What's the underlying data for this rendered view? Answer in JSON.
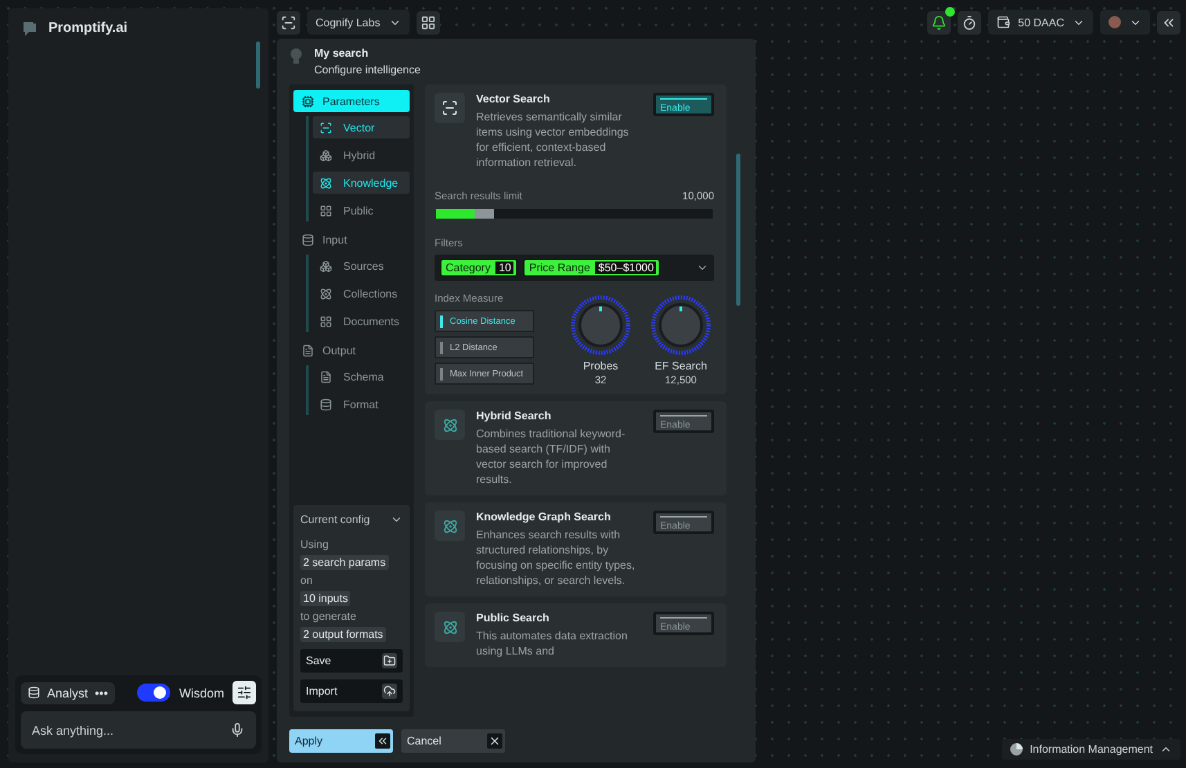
{
  "sidebar": {
    "brand": "Promptify.ai",
    "agent": "Analyst",
    "agent_menu": "•••",
    "wisdom": {
      "label": "Wisdom",
      "on": true
    },
    "ask": {
      "placeholder": "Ask anything..."
    }
  },
  "topbar": {
    "workspace": "Cognify Labs",
    "balance": "50 DAAC",
    "notifications": true
  },
  "panel": {
    "title": "My search",
    "subtitle": "Configure intelligence",
    "nav": [
      {
        "label": "Parameters",
        "selected": true,
        "children": [
          {
            "label": "Vector",
            "active": true
          },
          {
            "label": "Hybrid",
            "active": false
          },
          {
            "label": "Knowledge",
            "active": true
          },
          {
            "label": "Public",
            "active": false
          }
        ]
      },
      {
        "label": "Input",
        "selected": false,
        "children": [
          {
            "label": "Sources",
            "active": false
          },
          {
            "label": "Collections",
            "active": false
          },
          {
            "label": "Documents",
            "active": false
          }
        ]
      },
      {
        "label": "Output",
        "selected": false,
        "children": [
          {
            "label": "Schema",
            "active": false
          },
          {
            "label": "Format",
            "active": false
          }
        ]
      }
    ],
    "config": {
      "title": "Current config",
      "parts": [
        {
          "kind": "text",
          "text": "Using"
        },
        {
          "kind": "tag",
          "text": "2 search params"
        },
        {
          "kind": "text",
          "text": "on"
        },
        {
          "kind": "tag",
          "text": "10 inputs"
        },
        {
          "kind": "text",
          "text": "to generate"
        },
        {
          "kind": "tag",
          "text": "2 output formats"
        }
      ],
      "actions": [
        "Save",
        "Import"
      ]
    },
    "cards": [
      {
        "title": "Vector Search",
        "description": "Retrieves semantically similar items using vector embeddings for efficient, context-based information retrieval.",
        "enable": "Enable",
        "on": true,
        "details": {
          "limit_label": "Search results limit",
          "limit_value": "10,000",
          "level": 0.14,
          "filters_label": "Filters",
          "filters": [
            {
              "label": "Category",
              "value": "10"
            },
            {
              "label": "Price Range",
              "value": "$50–$1000"
            }
          ],
          "measure_label": "Index Measure",
          "measures": [
            {
              "label": "Cosine Distance",
              "selected": true
            },
            {
              "label": "L2 Distance",
              "selected": false
            },
            {
              "label": "Max Inner Product",
              "selected": false
            }
          ],
          "knobs": [
            {
              "label": "Probes",
              "value": "32"
            },
            {
              "label": "EF Search",
              "value": "12,500"
            }
          ]
        }
      },
      {
        "title": "Hybrid Search",
        "description": "Combines traditional keyword-based search (TF/IDF) with vector search for improved results.",
        "enable": "Enable",
        "on": false
      },
      {
        "title": "Knowledge Graph Search",
        "description": "Enhances search results with structured relationships, by focusing on specific entity types, relationships, or search levels.",
        "enable": "Enable",
        "on": false
      },
      {
        "title": "Public Search",
        "description": "This automates data extraction using LLMs and",
        "enable": "Enable",
        "on": false
      }
    ],
    "buttons": [
      {
        "label": "Apply",
        "kind": "primary"
      },
      {
        "label": "Cancel",
        "kind": "secondary"
      }
    ]
  },
  "footer": {
    "label": "Information Management"
  }
}
